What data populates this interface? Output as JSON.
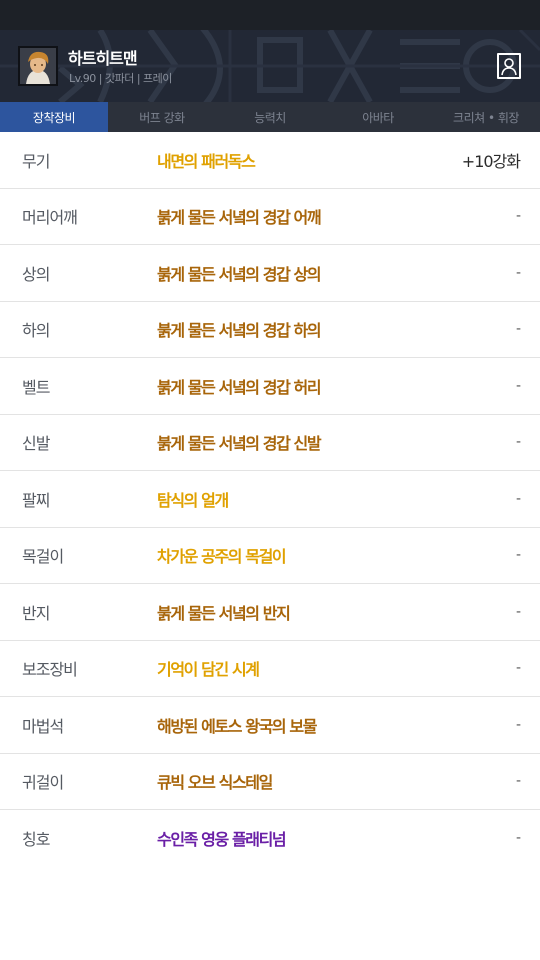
{
  "colors": {
    "epic": "#a8650a",
    "legendary": "#e0a100",
    "unique": "#6a1fa6"
  },
  "profile": {
    "name": "하트히트맨",
    "meta": "Lv.90 | 갓파더 | 프레이",
    "avatar_icon": "character-portrait",
    "profile_icon": "profile-card-icon"
  },
  "tabs": [
    {
      "label": "장착장비",
      "active": true
    },
    {
      "label": "버프 강화",
      "active": false
    },
    {
      "label": "능력치",
      "active": false
    },
    {
      "label": "아바타",
      "active": false
    },
    {
      "label": "크리쳐 • 휘장",
      "active": false
    }
  ],
  "equipment": [
    {
      "slot": "무기",
      "item": "내면의 패러독스",
      "grade": "legendary",
      "enhance": "+10강화"
    },
    {
      "slot": "머리어깨",
      "item": "붉게 물든 서녘의 경갑 어깨",
      "grade": "epic",
      "enhance": "-"
    },
    {
      "slot": "상의",
      "item": "붉게 물든 서녘의 경갑 상의",
      "grade": "epic",
      "enhance": "-"
    },
    {
      "slot": "하의",
      "item": "붉게 물든 서녘의 경갑 하의",
      "grade": "epic",
      "enhance": "-"
    },
    {
      "slot": "벨트",
      "item": "붉게 물든 서녘의 경갑 허리",
      "grade": "epic",
      "enhance": "-"
    },
    {
      "slot": "신발",
      "item": "붉게 물든 서녘의 경갑 신발",
      "grade": "epic",
      "enhance": "-"
    },
    {
      "slot": "팔찌",
      "item": "탐식의 얼개",
      "grade": "legendary",
      "enhance": "-"
    },
    {
      "slot": "목걸이",
      "item": "차가운 공주의 목걸이",
      "grade": "legendary",
      "enhance": "-"
    },
    {
      "slot": "반지",
      "item": "붉게 물든 서녘의 반지",
      "grade": "epic",
      "enhance": "-"
    },
    {
      "slot": "보조장비",
      "item": "기억이 담긴 시계",
      "grade": "legendary",
      "enhance": "-"
    },
    {
      "slot": "마법석",
      "item": "해방된 에토스 왕국의 보물",
      "grade": "epic",
      "enhance": "-"
    },
    {
      "slot": "귀걸이",
      "item": "큐빅 오브 식스테일",
      "grade": "epic",
      "enhance": "-"
    },
    {
      "slot": "칭호",
      "item": "수인족 영웅 플래티넘",
      "grade": "unique",
      "enhance": "-"
    }
  ]
}
